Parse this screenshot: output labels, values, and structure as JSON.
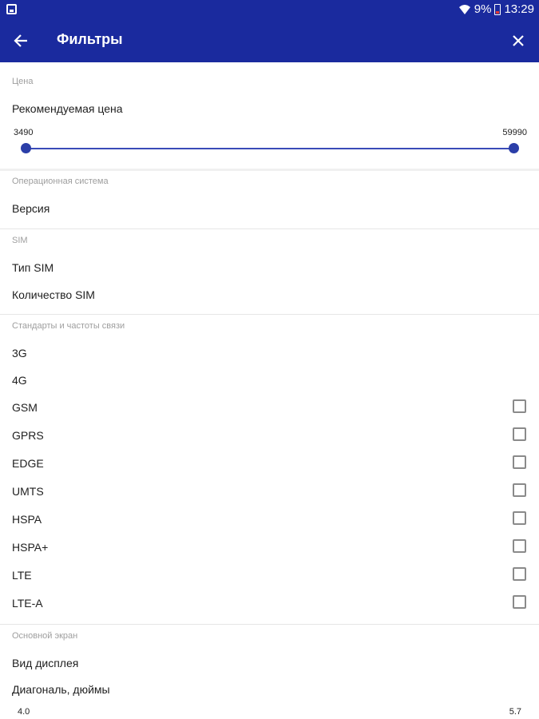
{
  "status_bar": {
    "battery": "9%",
    "time": "13:29"
  },
  "app_bar": {
    "title": "Фильтры"
  },
  "price": {
    "header": "Цена",
    "label": "Рекомендуемая цена",
    "min": "3490",
    "max": "59990"
  },
  "os": {
    "header": "Операционная система",
    "items": [
      "Версия"
    ]
  },
  "sim": {
    "header": "SIM",
    "items": [
      "Тип SIM",
      "Количество SIM"
    ]
  },
  "standards": {
    "header": "Стандарты и частоты связи",
    "items": [
      {
        "label": "3G",
        "checkbox": false
      },
      {
        "label": "4G",
        "checkbox": false
      },
      {
        "label": "GSM",
        "checkbox": true,
        "checked": false
      },
      {
        "label": "GPRS",
        "checkbox": true,
        "checked": false
      },
      {
        "label": "EDGE",
        "checkbox": true,
        "checked": false
      },
      {
        "label": "UMTS",
        "checkbox": true,
        "checked": false
      },
      {
        "label": "HSPA",
        "checkbox": true,
        "checked": false
      },
      {
        "label": "HSPA+",
        "checkbox": true,
        "checked": false
      },
      {
        "label": "LTE",
        "checkbox": true,
        "checked": false
      },
      {
        "label": "LTE-A",
        "checkbox": true,
        "checked": false
      }
    ]
  },
  "screen": {
    "header": "Основной экран",
    "items": [
      "Вид дисплея",
      "Диагональ, дюймы"
    ],
    "range_min": "4.0",
    "range_max": "5.7"
  },
  "colors": {
    "primary": "#1a2a9e",
    "accent": "#2b3ea8"
  }
}
